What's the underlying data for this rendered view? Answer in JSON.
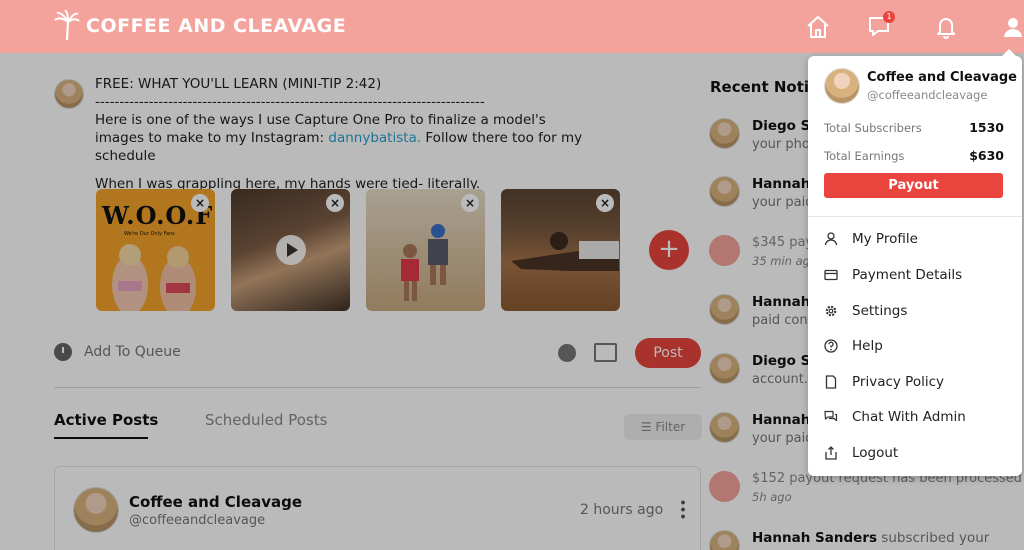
{
  "header": {
    "brand": "COFFEE AND CLEAVAGE",
    "chat_badge": "1"
  },
  "composer": {
    "title_line": "FREE: WHAT YOU'LL LEARN (MINI-TIP 2:42)",
    "separator": "--------------------------------------------------------------------------------",
    "body_line_1_prefix": "Here is one of the ways I use Capture One Pro to finalize a model's images to make to my Instagram: ",
    "body_link": "dannybatista.",
    "body_line_1_suffix": " Follow there too for my schedule",
    "body_line_2": "When I was grappling here, my hands were tied- literally.",
    "thumb1_title": "W.O.O.F",
    "thumb1_subtitle": "We're Our Only Fans",
    "remove_glyph": "×",
    "add_media_glyph": "+",
    "queue_label": "Add To Queue",
    "post_label": "Post"
  },
  "tabs": {
    "active": "Active Posts",
    "scheduled": "Scheduled Posts",
    "filter": "Filter"
  },
  "post_card": {
    "name": "Coffee and Cleavage",
    "handle": "@coffeeandcleavage",
    "time": "2 hours ago"
  },
  "notifications": {
    "heading": "Recent Notif",
    "items": [
      {
        "name": "Diego Sa",
        "sub": "your pho"
      },
      {
        "name": "Hannah S",
        "sub": "your paid"
      },
      {
        "amount": "$345 pay",
        "time": "35 min ag"
      },
      {
        "name": "Hannah S",
        "sub": "paid cont"
      },
      {
        "name": "Diego Sa",
        "sub": "account."
      },
      {
        "name": "Hannah S",
        "sub": "your paid"
      },
      {
        "amount": "$152 payout request has been processed",
        "time": "5h ago"
      },
      {
        "name": "Hannah Sanders",
        "sub_inline": " subscribed your"
      }
    ]
  },
  "dropdown": {
    "name": "Coffee and Cleavage",
    "handle": "@coffeeandcleavage",
    "subscribers_label": "Total Subscribers",
    "subscribers_value": "1530",
    "earnings_label": "Total Earnings",
    "earnings_value": "$630",
    "payout_label": "Payout",
    "menu": [
      {
        "label": "My Profile",
        "icon": "user-icon"
      },
      {
        "label": "Payment Details",
        "icon": "credit-card-icon"
      },
      {
        "label": "Settings",
        "icon": "gear-icon"
      },
      {
        "label": "Help",
        "icon": "help-icon"
      },
      {
        "label": "Privacy Policy",
        "icon": "document-icon"
      },
      {
        "label": "Chat With Admin",
        "icon": "chat-icon"
      },
      {
        "label": "Logout",
        "icon": "logout-icon"
      }
    ]
  },
  "colors": {
    "header": "#f4a39c",
    "accent": "#e9453e",
    "link": "#2a9fd0"
  }
}
